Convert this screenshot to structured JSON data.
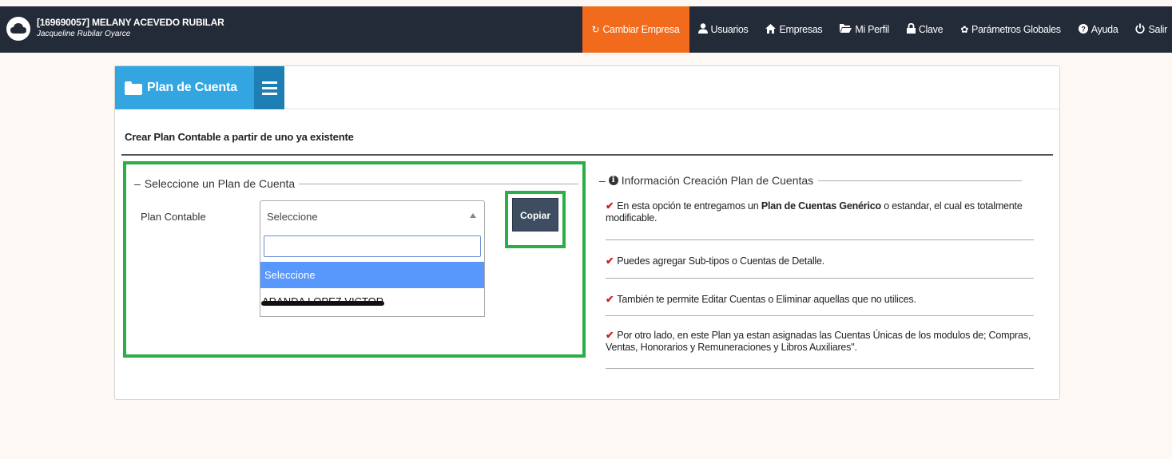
{
  "header": {
    "user_id": "[169690057] MELANY ACEVEDO RUBILAR",
    "user_sub": "Jacqueline Rubilar Oyarce"
  },
  "nav": {
    "items": [
      {
        "label": "Cambiar Empresa",
        "icon": "refresh-icon",
        "active": true
      },
      {
        "label": "Usuarios",
        "icon": "user-icon"
      },
      {
        "label": "Empresas",
        "icon": "home-icon"
      },
      {
        "label": "Mi Perfil",
        "icon": "folder-open-icon"
      },
      {
        "label": "Clave",
        "icon": "lock-icon"
      },
      {
        "label": "Parámetros Globales",
        "icon": "gear-icon"
      },
      {
        "label": "Ayuda",
        "icon": "question-icon"
      },
      {
        "label": "Salir",
        "icon": "power-icon"
      }
    ]
  },
  "page": {
    "title": "Plan de Cuenta",
    "subtitle": "Crear Plan Contable a partir de uno ya existente"
  },
  "form": {
    "legend": "Seleccione un Plan de Cuenta",
    "plan_label": "Plan Contable",
    "select_value": "Seleccione",
    "search_value": "",
    "options": [
      "Seleccione",
      "ARANDA LOPEZ VICTOR"
    ],
    "copy_label": "Copiar"
  },
  "info": {
    "legend": "Información Creación Plan de Cuentas",
    "item1_pre": "En esta opción te entregamos un ",
    "item1_bold": "Plan de Cuentas Genérico",
    "item1_post": " o estandar, el cual es totalmente modificable.",
    "item2": "Puedes agregar Sub-tipos o Cuentas de Detalle.",
    "item3": "También te permite Editar Cuentas o Eliminar aquellas que no utilices.",
    "item4": "Por otro lado, en este Plan ya estan asignadas las Cuentas Únicas de los modulos de; Compras, Ventas, Honorarios y Remuneraciones y Libros Auxiliares\"."
  },
  "colors": {
    "topbar": "#232b38",
    "active_nav": "#f26b1d",
    "title_tab": "#33a5e0",
    "menu_btn": "#1d7fb3",
    "highlight_green": "#2bad47",
    "selected_option": "#5897fb",
    "check": "#cc2222"
  }
}
